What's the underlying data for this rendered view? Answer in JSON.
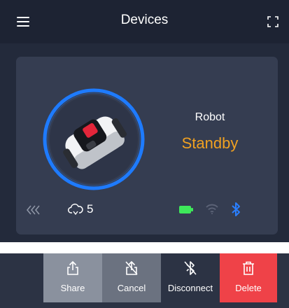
{
  "header": {
    "title": "Devices",
    "menu_icon": "hamburger-menu-icon",
    "fullscreen_icon": "fullscreen-icon"
  },
  "device": {
    "name": "Robot",
    "status": "Standby",
    "status_color": "#f0a121",
    "ring_color": "#1e7bff",
    "cloud_count": "5",
    "icons": [
      "double-chevron-left-icon",
      "cloud-icon",
      "battery-icon",
      "wifi-icon",
      "bluetooth-icon"
    ],
    "battery_color": "#3ee85a",
    "bluetooth_color": "#2a7fff"
  },
  "actions": {
    "share": "Share",
    "cancel": "Cancel",
    "disconnect": "Disconnect",
    "delete": "Delete",
    "delete_color": "#ef4248"
  }
}
